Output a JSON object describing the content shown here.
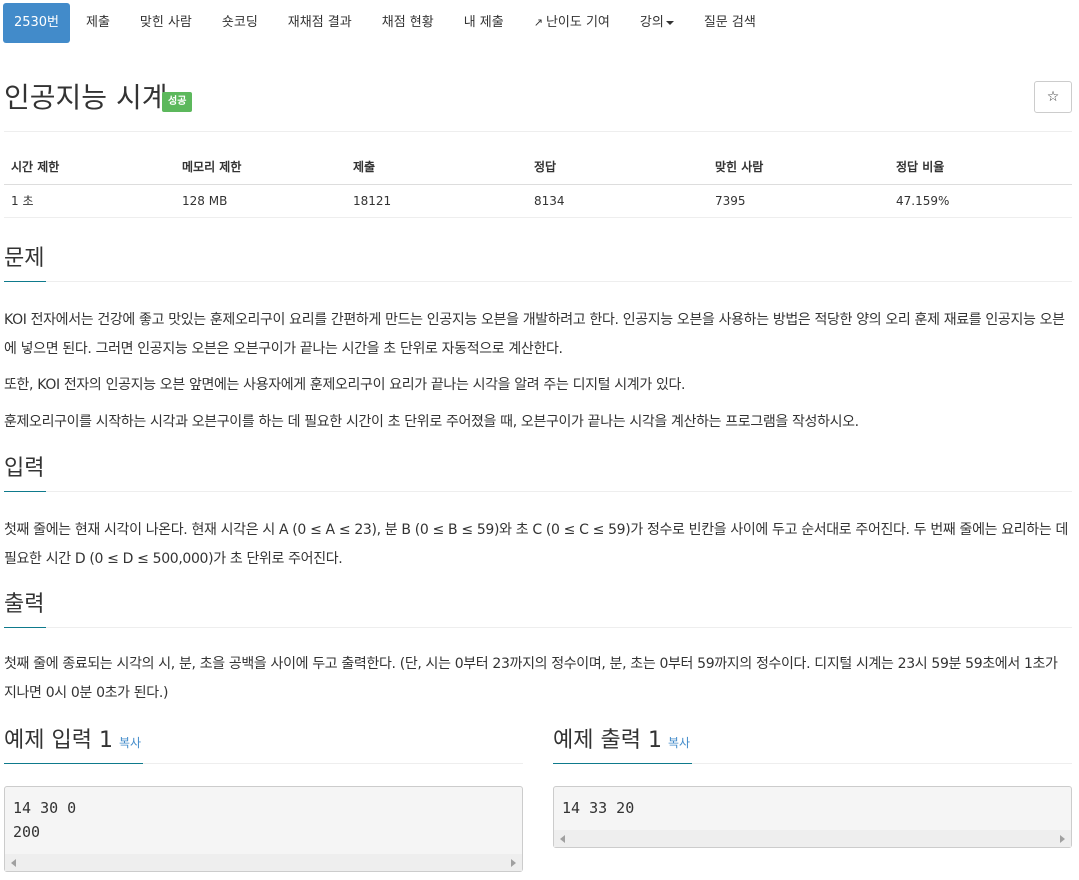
{
  "nav": {
    "tabs": [
      {
        "label": "2530번",
        "active": true
      },
      {
        "label": "제출"
      },
      {
        "label": "맞힌 사람"
      },
      {
        "label": "숏코딩"
      },
      {
        "label": "재채점 결과"
      },
      {
        "label": "채점 현황"
      },
      {
        "label": "내 제출"
      },
      {
        "label": "난이도 기여",
        "icon": "external-link-icon"
      },
      {
        "label": "강의",
        "icon": "caret-down-icon"
      },
      {
        "label": "질문 검색"
      }
    ]
  },
  "problem": {
    "title": "인공지능 시계",
    "badge": "성공",
    "star_icon": "☆"
  },
  "stats": {
    "headers": [
      "시간 제한",
      "메모리 제한",
      "제출",
      "정답",
      "맞힌 사람",
      "정답 비율"
    ],
    "values": [
      "1 초",
      "128 MB",
      "18121",
      "8134",
      "7395",
      "47.159%"
    ]
  },
  "sections": {
    "problem_head": "문제",
    "problem_body": [
      "KOI 전자에서는 건강에 좋고 맛있는 훈제오리구이 요리를 간편하게 만드는 인공지능 오븐을 개발하려고 한다. 인공지능 오븐을 사용하는 방법은 적당한 양의 오리 훈제 재료를 인공지능 오븐에 넣으면 된다. 그러면 인공지능 오븐은 오븐구이가 끝나는 시간을 초 단위로 자동적으로 계산한다.",
      "또한, KOI 전자의 인공지능 오븐 앞면에는 사용자에게 훈제오리구이 요리가 끝나는 시각을 알려 주는 디지털 시계가 있다.",
      "훈제오리구이를 시작하는 시각과 오븐구이를 하는 데 필요한 시간이 초 단위로 주어졌을 때, 오븐구이가 끝나는 시각을 계산하는 프로그램을 작성하시오."
    ],
    "input_head": "입력",
    "input_body": "첫째 줄에는 현재 시각이 나온다. 현재 시각은 시 A (0 ≤ A ≤ 23), 분 B (0 ≤ B ≤ 59)와 초 C (0 ≤ C ≤ 59)가 정수로 빈칸을 사이에 두고 순서대로 주어진다. 두 번째 줄에는 요리하는 데 필요한 시간 D (0 ≤ D ≤ 500,000)가 초 단위로 주어진다.",
    "output_head": "출력",
    "output_body": "첫째 줄에 종료되는 시각의 시, 분, 초을 공백을 사이에 두고 출력한다. (단, 시는 0부터 23까지의 정수이며, 분, 초는 0부터 59까지의 정수이다. 디지털 시계는 23시 59분 59초에서 1초가 지나면 0시 0분 0초가 된다.)"
  },
  "samples": {
    "input_title": "예제 입력 1",
    "output_title": "예제 출력 1",
    "copy_label": "복사",
    "input_text": "14 30 0\n200",
    "output_text": "14 33 20"
  }
}
